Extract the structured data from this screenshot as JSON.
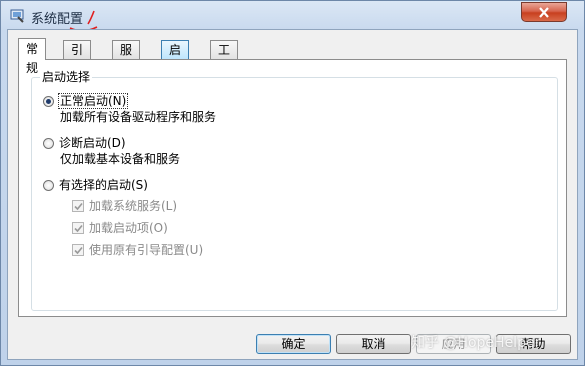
{
  "window": {
    "title": "系统配置",
    "close_icon": "close-icon"
  },
  "tabs": [
    {
      "label": "常规",
      "active": true
    },
    {
      "label": "引导"
    },
    {
      "label": "服务"
    },
    {
      "label": "启动"
    },
    {
      "label": "工具"
    }
  ],
  "startup_group": {
    "label": "启动选择",
    "normal": {
      "label": "正常启动(N)",
      "desc": "加载所有设备驱动程序和服务",
      "selected": true
    },
    "diagnostic": {
      "label": "诊断启动(D)",
      "desc": "仅加载基本设备和服务"
    },
    "selective": {
      "label": "有选择的启动(S)",
      "options": [
        {
          "label": "加载系统服务(L)",
          "checked": true
        },
        {
          "label": "加载启动项(O)",
          "checked": true
        },
        {
          "label": "使用原有引导配置(U)",
          "checked": true
        }
      ]
    }
  },
  "buttons": {
    "ok": "确定",
    "cancel": "取消",
    "apply": "应用",
    "help": "帮助"
  },
  "watermark": "知乎 @HopeHelper",
  "colors": {
    "accent": "#3c7fb1",
    "close": "#c8401f",
    "annotation": "#e02020"
  }
}
